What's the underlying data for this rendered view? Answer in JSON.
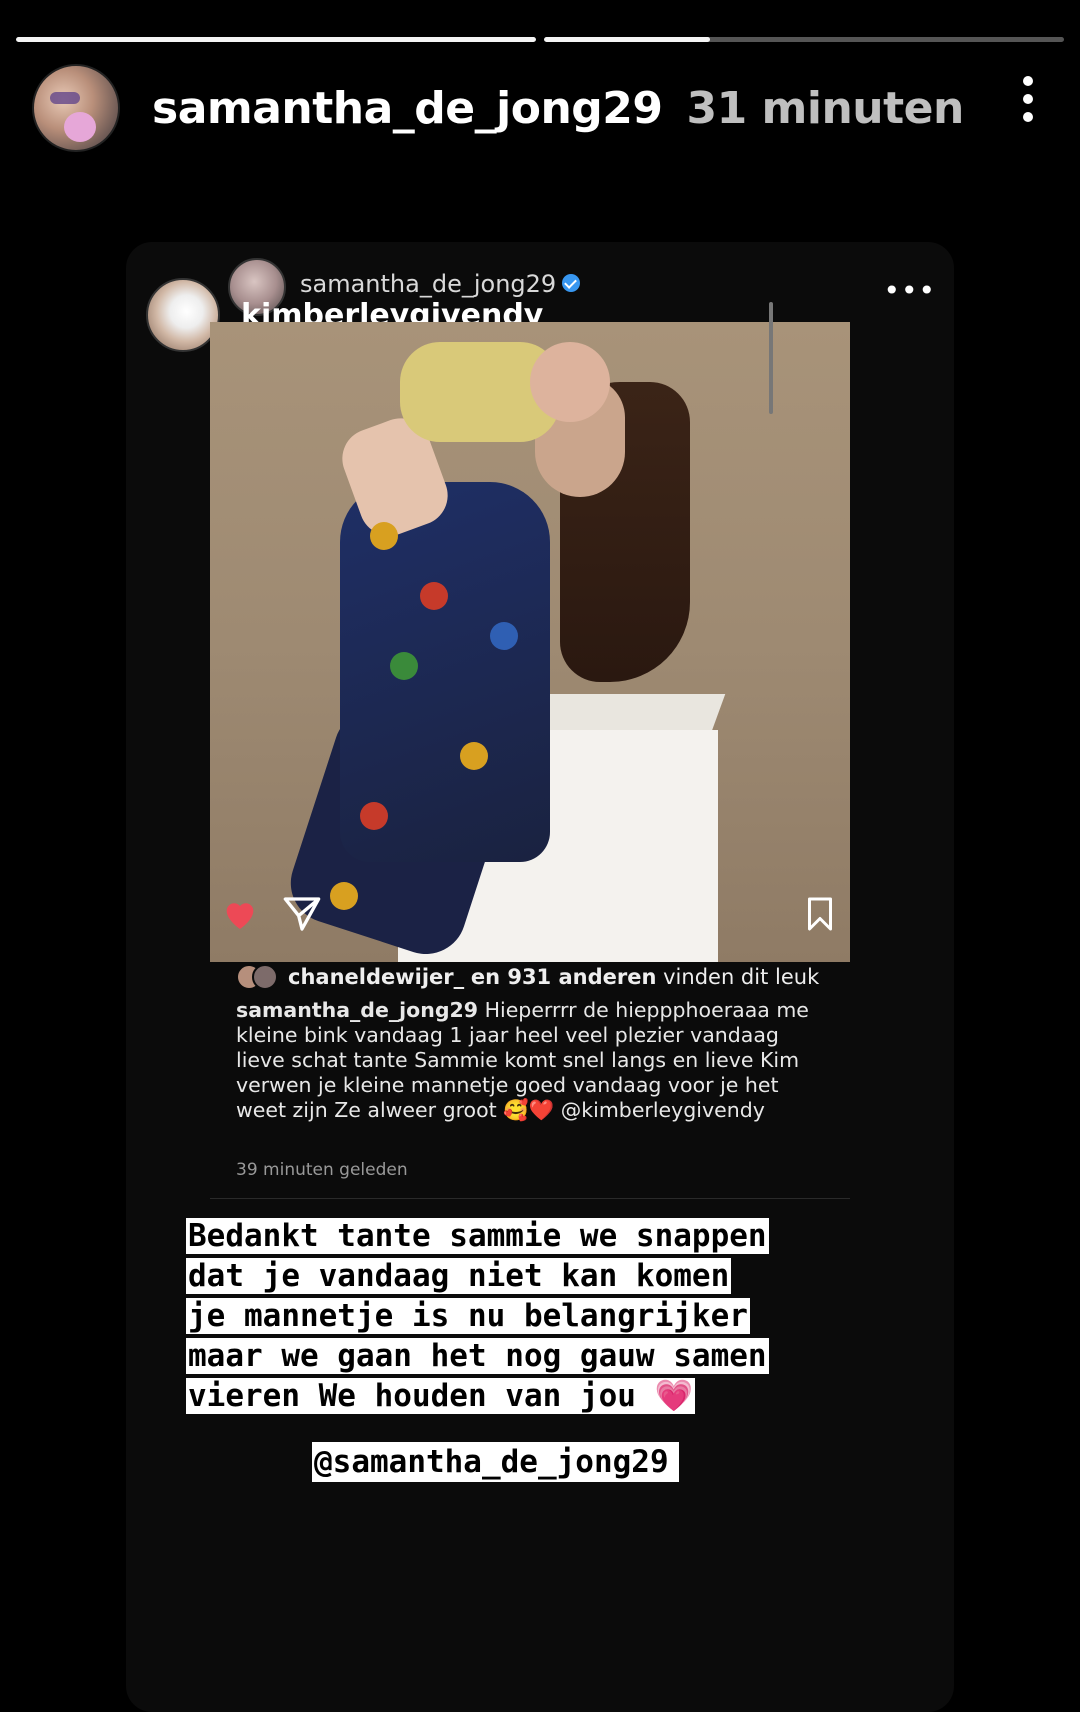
{
  "story": {
    "username": "samantha_de_jong29",
    "time": "31 minuten",
    "progress": [
      1.0,
      0.32
    ]
  },
  "post": {
    "original_user": "samantha_de_jong29",
    "tagged_user": "kimberleygivendy",
    "more_label": "•••",
    "likes_user": "chaneldewijer_",
    "likes_count": "en 931 anderen",
    "likes_suffix": "vinden dit leuk",
    "caption_user": "samantha_de_jong29",
    "caption_text": "Hieperrrr de hieppphoeraaa me kleine bink vandaag 1 jaar heel veel plezier vandaag lieve schat tante Sammie komt snel langs en lieve Kim verwen je kleine mannetje goed vandaag voor je het weet zijn Ze alweer groot 🥰❤️ @kimberleygivendy",
    "time_ago": "39 minuten geleden",
    "heart_color": "#ed4956"
  },
  "overlay": {
    "lines": [
      "Bedankt tante sammie we snappen",
      "dat je vandaag niet kan komen",
      "je mannetje is nu belangrijker",
      "maar we gaan het nog gauw samen",
      "vieren We houden van jou 💗"
    ],
    "mention": "@samantha_de_jong29"
  }
}
